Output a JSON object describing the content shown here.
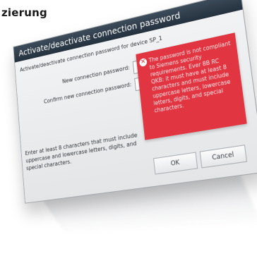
{
  "page": {
    "heading": "zierung"
  },
  "dialog": {
    "title": "Activate/deactivate connection password",
    "description": "Activate/deactivate connection password for device SP_1",
    "new_password_label": "New connection password:",
    "new_password_value": "*****",
    "confirm_password_label": "Confirm new connection password:",
    "confirm_password_value": "",
    "hint": "Enter at least 8 characters that must include uppercase and lowercase letters, digits, and special characters.",
    "error_message": "The password is not compliant to Siemens security requirements. Ever 8B RC QKB: it must have at least 8 characters and must include uppercase letters, lowercase letters, digits, and special characters.",
    "ok_label": "OK",
    "cancel_label": "Cancel"
  },
  "colors": {
    "titlebar": "#2f3c49",
    "error": "#e23542",
    "dialog_bg": "#eceef0"
  },
  "icons": {
    "error": "error-x-icon"
  }
}
